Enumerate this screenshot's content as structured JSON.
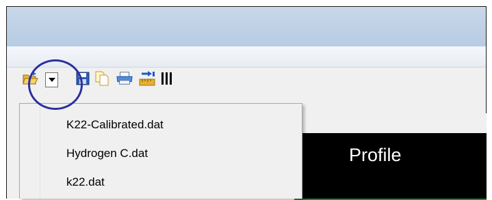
{
  "toolbar": {
    "open_icon": "open-folder-icon",
    "dropdown_icon": "chevron-down-icon",
    "save_icon": "save-disk-icon",
    "copy_icon": "copy-document-icon",
    "print_icon": "printer-icon",
    "export_icon": "export-ruler-icon",
    "columns_icon": "columns-icon"
  },
  "recent_files_menu": {
    "items": [
      {
        "label": "K22-Calibrated.dat"
      },
      {
        "label": "Hydrogen C.dat"
      },
      {
        "label": "k22.dat"
      }
    ]
  },
  "panel": {
    "title": "Profile"
  },
  "colors": {
    "highlight_ring": "#2b2f9e",
    "panel_bg": "#000000",
    "panel_accent": "#1f8a2e"
  }
}
